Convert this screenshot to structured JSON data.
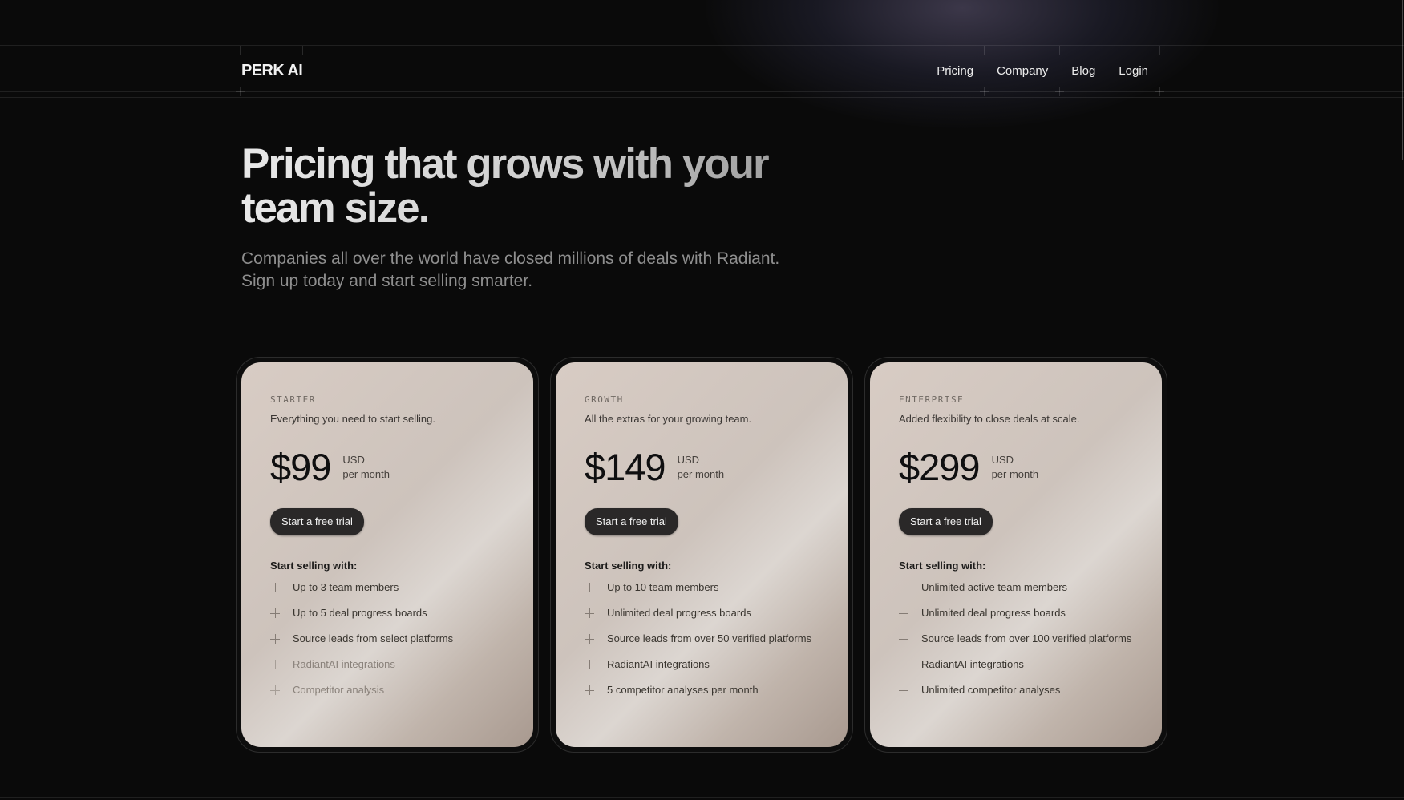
{
  "nav": {
    "logo": "PERK AI",
    "links": [
      "Pricing",
      "Company",
      "Blog",
      "Login"
    ]
  },
  "hero": {
    "title": "Pricing that grows with your team size.",
    "subtitle": "Companies all over the world have closed millions of deals with Radiant. Sign up today and start selling smarter."
  },
  "plans": [
    {
      "tier": "STARTER",
      "description": "Everything you need to start selling.",
      "price": "$99",
      "currency": "USD",
      "period": "per month",
      "cta": "Start a free trial",
      "features_heading": "Start selling with:",
      "features": [
        {
          "text": "Up to 3 team members",
          "muted": false
        },
        {
          "text": "Up to 5 deal progress boards",
          "muted": false
        },
        {
          "text": "Source leads from select platforms",
          "muted": false
        },
        {
          "text": "RadiantAI integrations",
          "muted": true
        },
        {
          "text": "Competitor analysis",
          "muted": true
        }
      ]
    },
    {
      "tier": "GROWTH",
      "description": "All the extras for your growing team.",
      "price": "$149",
      "currency": "USD",
      "period": "per month",
      "cta": "Start a free trial",
      "features_heading": "Start selling with:",
      "features": [
        {
          "text": "Up to 10 team members",
          "muted": false
        },
        {
          "text": "Unlimited deal progress boards",
          "muted": false
        },
        {
          "text": "Source leads from over 50 verified platforms",
          "muted": false
        },
        {
          "text": "RadiantAI integrations",
          "muted": false
        },
        {
          "text": "5 competitor analyses per month",
          "muted": false
        }
      ]
    },
    {
      "tier": "ENTERPRISE",
      "description": "Added flexibility to close deals at scale.",
      "price": "$299",
      "currency": "USD",
      "period": "per month",
      "cta": "Start a free trial",
      "features_heading": "Start selling with:",
      "features": [
        {
          "text": "Unlimited active team members",
          "muted": false
        },
        {
          "text": "Unlimited deal progress boards",
          "muted": false
        },
        {
          "text": "Source leads from over 100 verified platforms",
          "muted": false
        },
        {
          "text": "RadiantAI integrations",
          "muted": false
        },
        {
          "text": "Unlimited competitor analyses",
          "muted": false
        }
      ]
    }
  ]
}
